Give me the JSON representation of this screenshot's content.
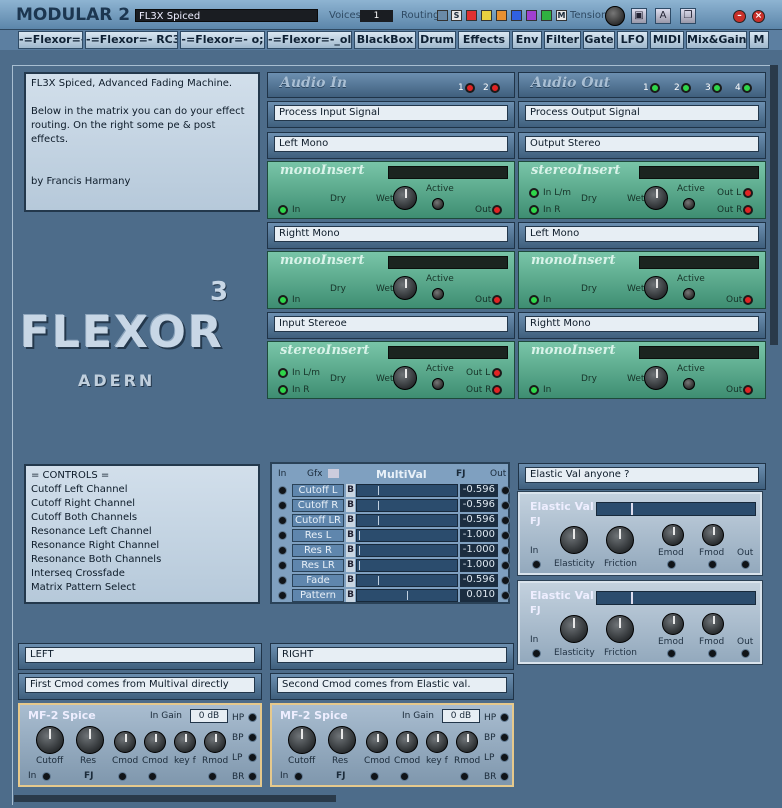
{
  "titlebar": {
    "app_title": "MODULAR 2",
    "preset_name": "FL3X Spiced",
    "voices_label": "Voices",
    "voices_value": "1",
    "routing_label": "Routing",
    "routing_s": "S",
    "routing_m": "M",
    "tension_label": "Tension",
    "icon_letter": "A"
  },
  "tabs": [
    "-=Flexor=-.",
    "-=Flexor=- RC3",
    "-=Flexor=- o;",
    "-=Flexor=-_old",
    "BlackBox",
    "Drum",
    "Effects",
    "Env",
    "Filter",
    "Gate",
    "LFO",
    "MIDI",
    "Mix&Gain",
    "M"
  ],
  "description": "FL3X Spiced, Advanced Fading Machine.\n\nBelow in the matrix you can do your effect routing. On the right some pe & post effects.\n\n\nby Francis Harmany",
  "audio_in": {
    "title": "Audio In",
    "ports": [
      "1",
      "2"
    ]
  },
  "audio_out": {
    "title": "Audio Out",
    "ports": [
      "1",
      "2",
      "3",
      "4"
    ]
  },
  "left_col": {
    "process": "Process Input Signal",
    "slot1": "Left Mono",
    "slot2": "Rightt Mono",
    "slot3": "Input Stereoe"
  },
  "right_col": {
    "process": "Process Output Signal",
    "slot1": "Output Stereo",
    "slot2": "Left Mono",
    "slot3": "Rightt Mono"
  },
  "inserts": {
    "mono": "monoInsert",
    "stereo": "stereoInsert",
    "dry": "Dry",
    "wet": "Wet",
    "active": "Active",
    "in": "In",
    "out": "Out",
    "in_lm": "In L/m",
    "in_r": "In R",
    "out_l": "Out L",
    "out_r": "Out R"
  },
  "logo": {
    "word": "FLEXOR",
    "sup": "3",
    "brand": "ADERN"
  },
  "controls": "= CONTROLS =\nCutoff Left Channel\nCutoff Right Channel\nCutoff Both Channels\nResonance Left Channel\nResonance Right Channel\nResonance Both Channels\nInterseq Crossfade\nMatrix Pattern Select",
  "multival": {
    "title": "MultiVal",
    "in": "In",
    "gfx": "Gfx",
    "fj": "FJ",
    "out": "Out",
    "b": "B",
    "rows": [
      {
        "name": "Cutoff L",
        "value": "-0.596",
        "level": 0.2
      },
      {
        "name": "Cutoff R",
        "value": "-0.596",
        "level": 0.2
      },
      {
        "name": "Cutoff LR",
        "value": "-0.596",
        "level": 0.2
      },
      {
        "name": "Res L",
        "value": "-1.000",
        "level": 0
      },
      {
        "name": "Res R",
        "value": "-1.000",
        "level": 0
      },
      {
        "name": "Res LR",
        "value": "-1.000",
        "level": 0
      },
      {
        "name": "Fade",
        "value": "-0.596",
        "level": 0.2
      },
      {
        "name": "Pattern",
        "value": "0.010",
        "level": 0.5
      }
    ]
  },
  "elastic": {
    "header": "Elastic Val anyone ?",
    "title": "Elastic Val",
    "fj": "FJ",
    "in": "In",
    "elasticity": "Elasticity",
    "friction": "Friction",
    "emod": "Emod",
    "fmod": "Fmod",
    "out": "Out"
  },
  "mf_labels": {
    "left": "LEFT",
    "right": "RIGHT",
    "left_desc": "First Cmod comes from Multival directly",
    "right_desc": "Second Cmod comes from Elastic val."
  },
  "mf": {
    "title": "MF-2 Spice",
    "in_gain": "In Gain",
    "gain_value": "0 dB",
    "hp": "HP",
    "bp": "BP",
    "lp": "LP",
    "br": "BR",
    "cutoff": "Cutoff",
    "res": "Res",
    "cmod": "Cmod",
    "keyf": "key f",
    "rmod": "Rmod",
    "in": "In",
    "fj": "FJ"
  },
  "colors": {
    "accent": "#5c86aa",
    "insert": "#4fa685",
    "filter_border": "#e6c98c"
  }
}
